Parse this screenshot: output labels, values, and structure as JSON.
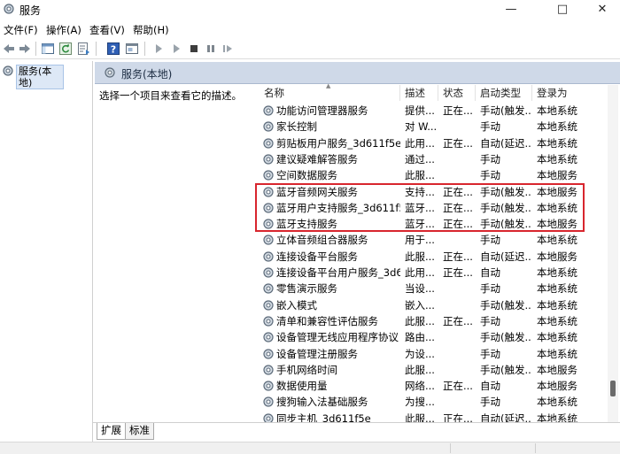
{
  "window": {
    "title": "服务",
    "controls": [
      "minimize",
      "maximize",
      "close"
    ]
  },
  "menu": [
    "文件(F)",
    "操作(A)",
    "查看(V)",
    "帮助(H)"
  ],
  "toolbar": {
    "buttons": [
      "back-icon",
      "forward-icon",
      "show-hide-tree-icon",
      "refresh-icon",
      "export-list-icon",
      "help-icon",
      "properties-icon",
      "start-service-icon",
      "stop-service-icon",
      "pause-service-icon",
      "restart-service-icon"
    ]
  },
  "tree": {
    "selected_label": "服务(本地)"
  },
  "panel": {
    "header_title": "服务(本地)",
    "description_hint": "选择一个项目来查看它的描述。"
  },
  "columns": [
    "名称",
    "描述",
    "状态",
    "启动类型",
    "登录为"
  ],
  "services": [
    {
      "name": "功能访问管理器服务",
      "desc": "提供...",
      "status": "正在...",
      "startup": "手动(触发...",
      "login": "本地系统"
    },
    {
      "name": "家长控制",
      "desc": "对 W...",
      "status": "",
      "startup": "手动",
      "login": "本地系统"
    },
    {
      "name": "剪贴板用户服务_3d611f5e",
      "desc": "此用...",
      "status": "正在...",
      "startup": "自动(延迟...",
      "login": "本地系统"
    },
    {
      "name": "建议疑难解答服务",
      "desc": "通过...",
      "status": "",
      "startup": "手动",
      "login": "本地系统"
    },
    {
      "name": "空间数据服务",
      "desc": "此服...",
      "status": "",
      "startup": "手动",
      "login": "本地服务"
    },
    {
      "name": "蓝牙音频网关服务",
      "desc": "支持...",
      "status": "正在...",
      "startup": "手动(触发...",
      "login": "本地服务"
    },
    {
      "name": "蓝牙用户支持服务_3d611f5e",
      "desc": "蓝牙...",
      "status": "正在...",
      "startup": "手动(触发...",
      "login": "本地系统"
    },
    {
      "name": "蓝牙支持服务",
      "desc": "蓝牙...",
      "status": "正在...",
      "startup": "手动(触发...",
      "login": "本地服务"
    },
    {
      "name": "立体音频组合器服务",
      "desc": "用于...",
      "status": "",
      "startup": "手动",
      "login": "本地系统"
    },
    {
      "name": "连接设备平台服务",
      "desc": "此服...",
      "status": "正在...",
      "startup": "自动(延迟...",
      "login": "本地服务"
    },
    {
      "name": "连接设备平台用户服务_3d6...",
      "desc": "此用...",
      "status": "正在...",
      "startup": "自动",
      "login": "本地系统"
    },
    {
      "name": "零售演示服务",
      "desc": "当设...",
      "status": "",
      "startup": "手动",
      "login": "本地系统"
    },
    {
      "name": "嵌入模式",
      "desc": "嵌入...",
      "status": "",
      "startup": "手动(触发...",
      "login": "本地系统"
    },
    {
      "name": "清单和兼容性评估服务",
      "desc": "此服...",
      "status": "正在...",
      "startup": "手动",
      "login": "本地系统"
    },
    {
      "name": "设备管理无线应用程序协议 ...",
      "desc": "路由...",
      "status": "",
      "startup": "手动(触发...",
      "login": "本地系统"
    },
    {
      "name": "设备管理注册服务",
      "desc": "为设...",
      "status": "",
      "startup": "手动",
      "login": "本地系统"
    },
    {
      "name": "手机网络时间",
      "desc": "此服...",
      "status": "",
      "startup": "手动(触发...",
      "login": "本地服务"
    },
    {
      "name": "数据使用量",
      "desc": "网络...",
      "status": "正在...",
      "startup": "自动",
      "login": "本地服务"
    },
    {
      "name": "搜狗输入法基础服务",
      "desc": "为搜...",
      "status": "",
      "startup": "手动",
      "login": "本地系统"
    },
    {
      "name": "同步主机_3d611f5e",
      "desc": "此服...",
      "status": "正在...",
      "startup": "自动(延迟...",
      "login": "本地系统"
    }
  ],
  "highlight": {
    "color": "#d8262e",
    "rows": [
      "蓝牙音频网关服务",
      "蓝牙用户支持服务_3d611f5e",
      "蓝牙支持服务"
    ]
  },
  "tabs": [
    "扩展",
    "标准"
  ],
  "colors": {
    "header_band": "#cfd9e8",
    "selection": "#dde8f6"
  }
}
